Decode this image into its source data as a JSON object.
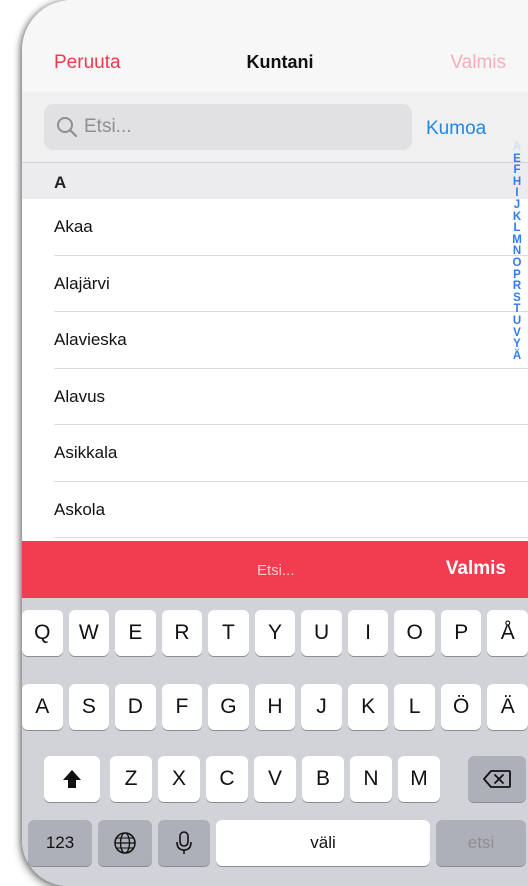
{
  "navbar": {
    "cancel": "Peruuta",
    "title": "Kuntani",
    "done": "Valmis"
  },
  "search": {
    "placeholder": "Etsi...",
    "cancel": "Kumoa",
    "icon": "search-icon"
  },
  "list": {
    "section": "A",
    "items": [
      "Akaa",
      "Alajärvi",
      "Alavieska",
      "Alavus",
      "Asikkala",
      "Askola"
    ]
  },
  "index": [
    "A",
    "E",
    "F",
    "H",
    "I",
    "J",
    "K",
    "L",
    "M",
    "N",
    "O",
    "P",
    "R",
    "S",
    "T",
    "U",
    "V",
    "Y",
    "Ä"
  ],
  "accessory": {
    "placeholder": "Etsi...",
    "done": "Valmis"
  },
  "keyboard": {
    "row1": [
      "Q",
      "W",
      "E",
      "R",
      "T",
      "Y",
      "U",
      "I",
      "O",
      "P",
      "Å"
    ],
    "row2": [
      "A",
      "S",
      "D",
      "F",
      "G",
      "H",
      "J",
      "K",
      "L",
      "Ö",
      "Ä"
    ],
    "row3": [
      "Z",
      "X",
      "C",
      "V",
      "B",
      "N",
      "M"
    ],
    "numbers": "123",
    "space": "väli",
    "search": "etsi"
  },
  "colors": {
    "accent": "#f23c50",
    "link": "#1e88e5",
    "index": "#2e7cf6"
  }
}
